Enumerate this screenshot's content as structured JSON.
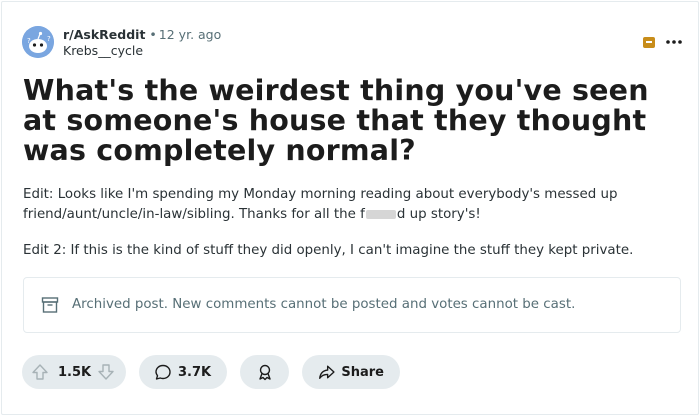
{
  "post": {
    "subreddit": "r/AskReddit",
    "separator": "•",
    "time": "12 yr. ago",
    "author": "Krebs__cycle",
    "more_label": "•••",
    "title": "What's the weirdest thing you've seen at someone's house that they thought was completely normal?",
    "body": {
      "edit1_part1": "Edit: Looks like I'm spending my Monday morning reading about everybody's messed up friend/aunt/uncle/in-law/sibling. Thanks for all the f",
      "edit1_part2": "d up story's!",
      "edit2": "Edit 2: If this is the kind of stuff they did openly, I can't imagine the stuff they kept private."
    },
    "archived_notice": "Archived post. New comments cannot be posted and votes cannot be cast."
  },
  "actions": {
    "votes": "1.5K",
    "comments": "3.7K",
    "share": "Share"
  },
  "colors": {
    "accent_archive": "#c88d1a",
    "pill_bg": "#e5ebee",
    "muted_text": "#576f76"
  },
  "icons": {
    "avatar": "snoo-avatar-icon",
    "archive": "archive-icon",
    "more": "more-options-icon",
    "upvote": "upvote-arrow-icon",
    "downvote": "downvote-arrow-icon",
    "comment": "comment-bubble-icon",
    "award": "award-icon",
    "share": "share-arrow-icon"
  }
}
